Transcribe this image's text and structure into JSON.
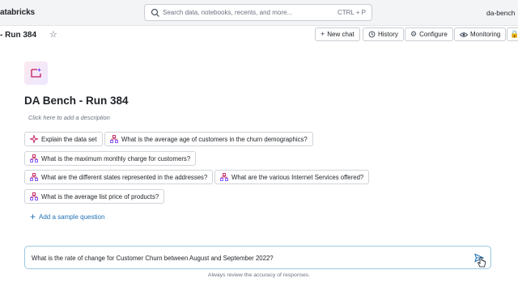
{
  "topbar": {
    "brand": "atabricks",
    "search_placeholder": "Search data, notebooks, recents, and more...",
    "search_shortcut": "CTRL + P",
    "workspace": "da-bench"
  },
  "titlebar": {
    "title": "- Run 384",
    "buttons": {
      "new_chat": "New chat",
      "history": "History",
      "configure": "Configure",
      "monitoring": "Monitoring"
    }
  },
  "space": {
    "title": "DA Bench - Run 384",
    "description_placeholder": "Click here to add a description"
  },
  "sample_questions": [
    "Explain the data set",
    "What is the average age of customers in the churn demographics?",
    "What is the maximum monthly charge for customers?",
    "What are the different states represented in the addresses?",
    "What are the various Internet Services offered?",
    "What is the average list price of products?"
  ],
  "add_sample_label": "Add a sample question",
  "chat": {
    "input_value": "What is the rate of change for Customer Churn between August and September 2022?"
  },
  "footnote": "Always review the accuracy of responses.",
  "colors": {
    "accent": "#2272b4",
    "icon_pink": "#c2185b",
    "icon_purple": "#7c4dff"
  }
}
